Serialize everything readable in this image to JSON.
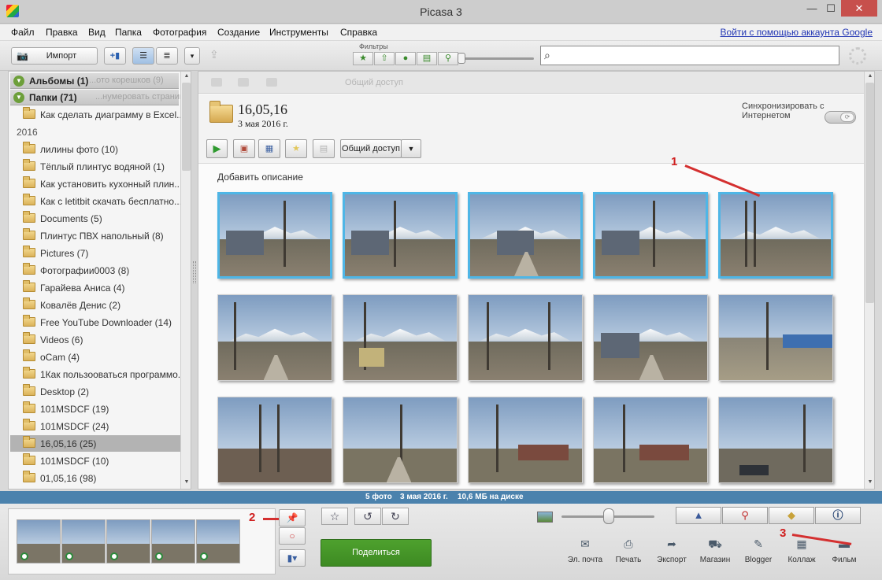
{
  "window": {
    "title": "Picasa 3",
    "min_glyph": "—",
    "max_glyph": "☐",
    "close_glyph": "✕"
  },
  "menu": {
    "items": [
      "Файл",
      "Правка",
      "Вид",
      "Папка",
      "Фотография",
      "Создание",
      "Инструменты",
      "Справка"
    ],
    "account_link": "Войти с помощью аккаунта Google"
  },
  "toolbar": {
    "import_label": "Импорт",
    "filters_label": "Фильтры",
    "search_placeholder": "",
    "filter_icons": [
      "star-icon",
      "upload-icon",
      "person-icon",
      "movie-icon",
      "pin-icon"
    ]
  },
  "left_panel": {
    "albums_header": "Альбомы (1)",
    "albums_ghost": "...ото корешков (9)",
    "folders_header": "Папки (71)",
    "folders_ghost": "...нумеровать страницы в ...",
    "first_folder": "Как сделать диаграмму в Excel...",
    "year": "2016",
    "folders": [
      "лилины фото (10)",
      "Тёплый плинтус водяной (1)",
      "Как установить кухонный плин...",
      "Как с letitbit скачать бесплатно...",
      "Documents (5)",
      "Плинтус ПВХ напольный (8)",
      "Pictures (7)",
      "Фотографии0003 (8)",
      "Гарайева Аниса (4)",
      "Ковалёв Денис (2)",
      "Free YouTube Downloader (14)",
      "Videos (6)",
      "oCam (4)",
      "1Как пользооваться программо...",
      "Desktop (2)",
      "101MSDCF (19)",
      "101MSDCF (24)",
      "16,05,16 (25)",
      "101MSDCF (10)",
      "01,05,16 (98)"
    ],
    "selected_folder": "16,05,16 (25)"
  },
  "main": {
    "ghost_text": "Общий доступ",
    "folder_title": "16,05,16",
    "folder_date": "3 мая 2016 г.",
    "sync_label": "Синхронизировать с Интернетом",
    "share_access_label": "Общий доступ",
    "add_description": "Добавить описание",
    "selected_count": 5,
    "visible_photos": 15
  },
  "status": {
    "photos": "5 фото",
    "date": "3 мая 2016 г.",
    "size": "10,6 МБ на диске"
  },
  "bottom": {
    "share_button": "Поделиться",
    "annotations": [
      "1",
      "2",
      "3"
    ],
    "actions": [
      {
        "label": "Эл. почта",
        "icon": "email-icon",
        "glyph": "✉"
      },
      {
        "label": "Печать",
        "icon": "print-icon",
        "glyph": "⎙"
      },
      {
        "label": "Экспорт",
        "icon": "export-icon",
        "glyph": "➦"
      },
      {
        "label": "Магазин",
        "icon": "shop-icon",
        "glyph": "⛟"
      },
      {
        "label": "Blogger",
        "icon": "blogger-icon",
        "glyph": "✎"
      },
      {
        "label": "Коллаж",
        "icon": "collage-icon",
        "glyph": "▦"
      },
      {
        "label": "Фильм",
        "icon": "film-icon",
        "glyph": "▬"
      }
    ],
    "right_tabs": [
      {
        "icon": "person-icon",
        "glyph": "👤"
      },
      {
        "icon": "map-pin-icon",
        "glyph": "📍"
      },
      {
        "icon": "tag-icon",
        "glyph": "🏷"
      },
      {
        "icon": "info-icon",
        "glyph": "ℹ"
      }
    ]
  },
  "colors": {
    "selection_border": "#4fb6e6",
    "status_bar": "#4b82ad",
    "share_green": "#4ea12e",
    "annotation_red": "#d02020"
  }
}
